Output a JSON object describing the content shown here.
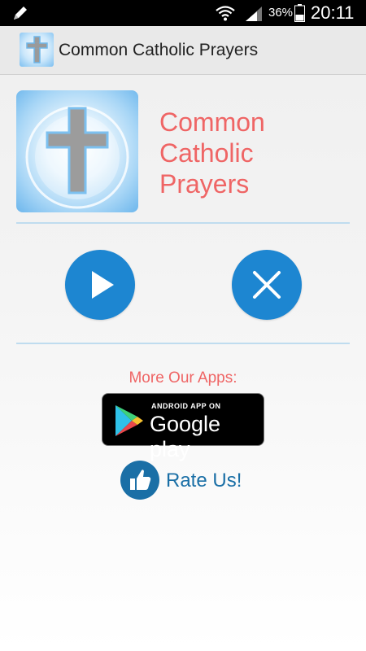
{
  "status_bar": {
    "battery_percent": "36%",
    "time": "20:11",
    "icons": [
      "pencil-icon",
      "wifi-icon",
      "signal-icon",
      "battery-icon"
    ]
  },
  "action_bar": {
    "title": "Common Catholic Prayers",
    "app_icon": "cross-icon"
  },
  "header": {
    "title_lines": [
      "Common",
      "Catholic",
      "Prayers"
    ],
    "icon": "cross-icon"
  },
  "controls": {
    "play_icon": "play-icon",
    "close_icon": "close-icon"
  },
  "more_apps": {
    "label": "More Our Apps:",
    "badge_small": "ANDROID APP ON",
    "badge_big": "Google play"
  },
  "rate": {
    "label": "Rate Us!",
    "icon": "thumbs-up-icon"
  },
  "colors": {
    "accent_red": "#ef6565",
    "button_blue": "#1d86d1",
    "rate_blue": "#1a6fa6",
    "divider": "#bfdcef"
  }
}
